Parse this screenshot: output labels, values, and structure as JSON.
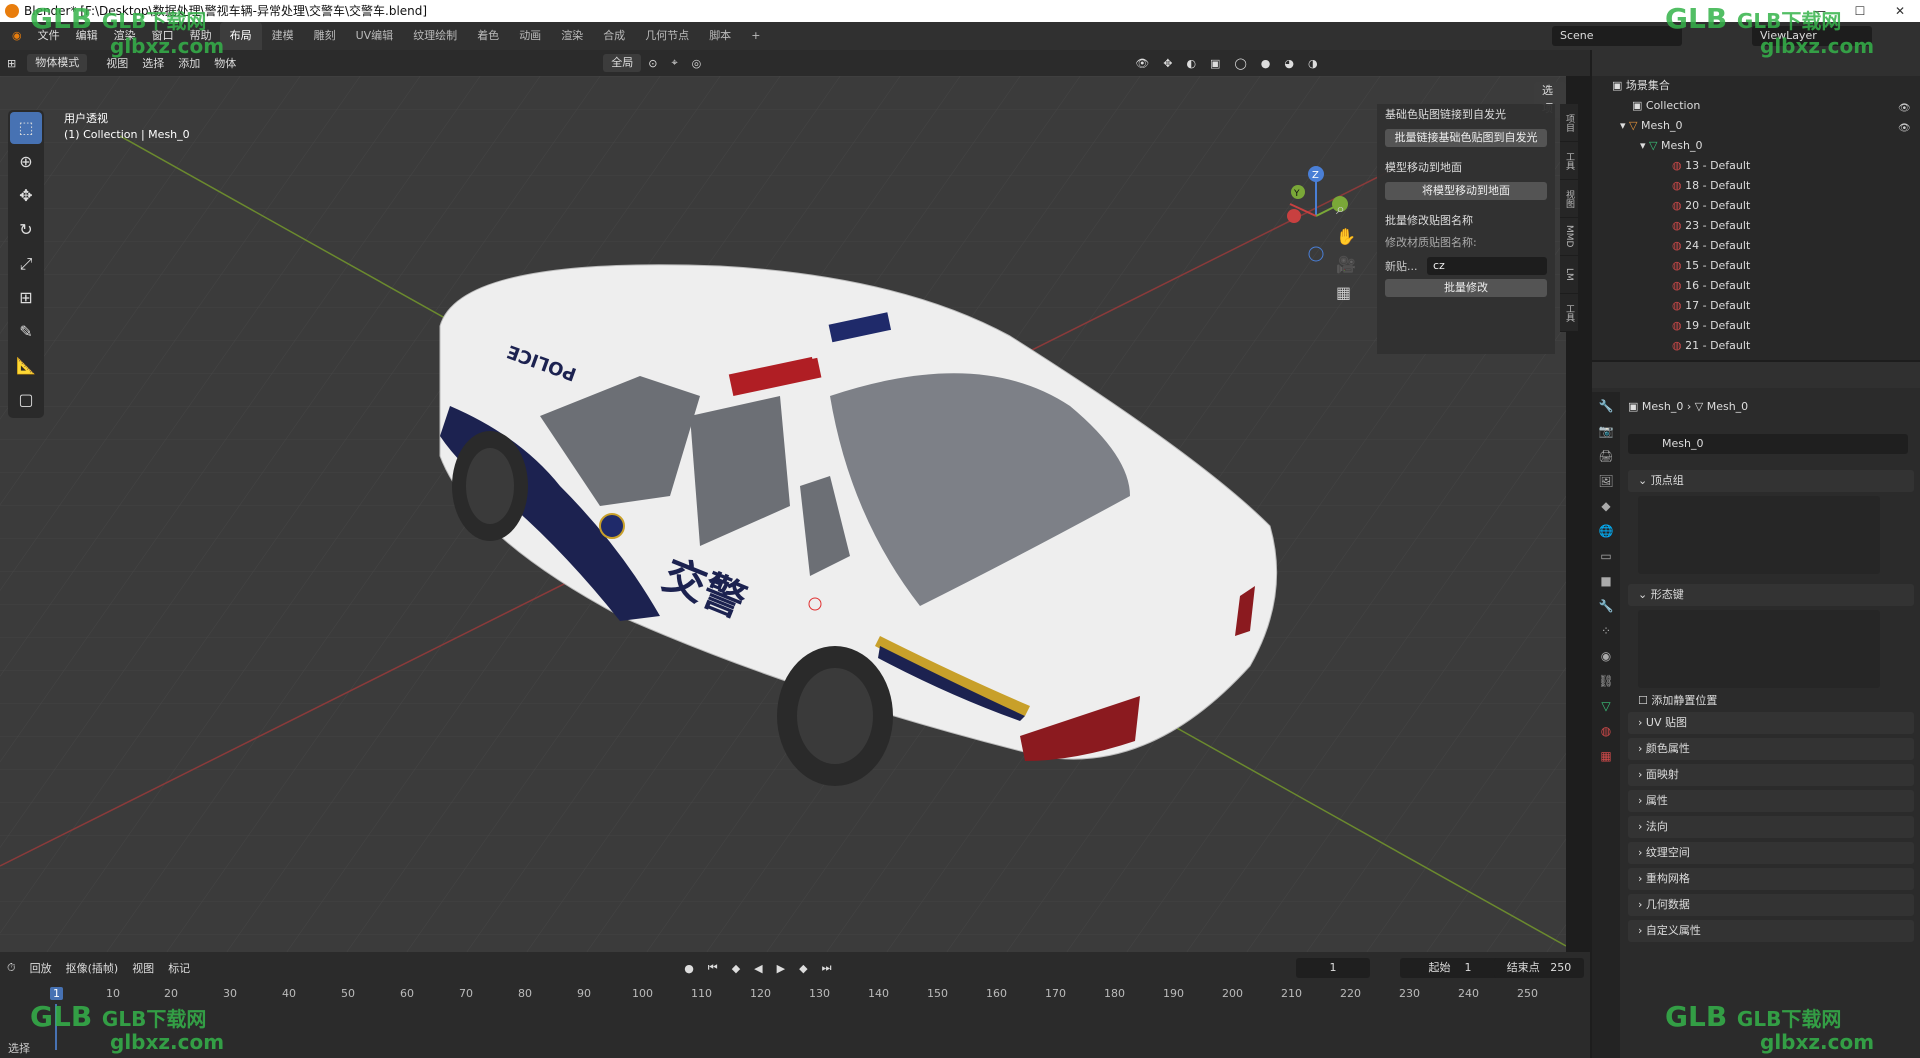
{
  "window": {
    "title": "Blender* [F:\\Desktop\\数据处理\\警视车辆-异常处理\\交警车\\交警车.blend]"
  },
  "menus": [
    "文件",
    "编辑",
    "渲染",
    "窗口",
    "帮助"
  ],
  "workspaces": [
    "布局",
    "建模",
    "雕刻",
    "UV编辑",
    "纹理绘制",
    "着色",
    "动画",
    "渲染",
    "合成",
    "几何节点",
    "脚本"
  ],
  "active_workspace": "布局",
  "scene": "Scene",
  "view_layer": "ViewLayer",
  "viewport_header": {
    "mode": "物体模式",
    "menus": [
      "视图",
      "选择",
      "添加",
      "物体"
    ],
    "transform_orientation": "全局",
    "options": "选项"
  },
  "viewport": {
    "view_name": "用户透视",
    "collection_info": "(1) Collection | Mesh_0"
  },
  "npanel": {
    "section1": "基础色贴图链接到自发光",
    "button1": "批量链接基础色贴图到自发光",
    "section2": "模型移动到地面",
    "button2": "将模型移动到地面",
    "section3": "批量修改贴图名称",
    "label3": "修改材质贴图名称:",
    "field_label": "新贴...",
    "field_value": "cz",
    "button3": "批量修改",
    "tabs": [
      "项目",
      "工具",
      "视图",
      "MMD",
      "LM",
      "工具"
    ]
  },
  "outliner": {
    "root": "场景集合",
    "collection": "Collection",
    "object": "Mesh_0",
    "mesh": "Mesh_0",
    "materials": [
      "13 - Default",
      "18 - Default",
      "20 - Default",
      "23 - Default",
      "24 - Default",
      "15 - Default",
      "16 - Default",
      "17 - Default",
      "19 - Default",
      "21 - Default"
    ]
  },
  "properties": {
    "breadcrumb_obj": "Mesh_0",
    "breadcrumb_data": "Mesh_0",
    "datablock": "Mesh_0",
    "vertex_groups": "顶点组",
    "shape_keys": "形态键",
    "add_rest_position": "添加静置位置",
    "sections": [
      "UV 贴图",
      "颜色属性",
      "面映射",
      "属性",
      "法向",
      "纹理空间",
      "重构网格",
      "几何数据",
      "自定义属性"
    ]
  },
  "timeline": {
    "menus": [
      "回放",
      "抠像(插帧)",
      "视图",
      "标记"
    ],
    "current_frame": "1",
    "start_label": "起始",
    "start": "1",
    "end_label": "结束点",
    "end": "250",
    "ticks": [
      "1",
      "10",
      "20",
      "30",
      "40",
      "50",
      "60",
      "70",
      "80",
      "90",
      "100",
      "110",
      "120",
      "130",
      "140",
      "150",
      "160",
      "170",
      "180",
      "190",
      "200",
      "210",
      "220",
      "230",
      "240",
      "250"
    ]
  },
  "status": {
    "left": "选择"
  },
  "watermark": {
    "text": "GLB下载网",
    "url": "glbxz.com"
  },
  "vehicle_text": {
    "door": "交警",
    "hood": "POLICE"
  }
}
